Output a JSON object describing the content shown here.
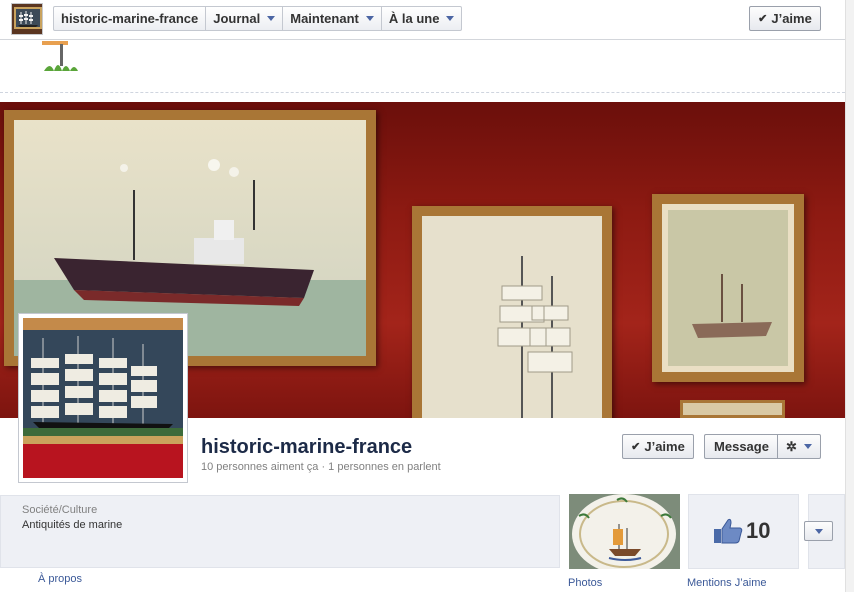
{
  "topbar": {
    "breadcrumbs": [
      "historic-marine-france",
      "Journal",
      "Maintenant",
      "À la une"
    ],
    "like_label": "J’aime"
  },
  "page": {
    "name": "historic-marine-france",
    "stats": "10 personnes aiment ça · 1 personnes en parlent",
    "like_label": "J’aime",
    "message_label": "Message"
  },
  "about": {
    "category": "Société/Culture",
    "description": "Antiquités de marine",
    "link_label": "À propos"
  },
  "tabs": {
    "photos_label": "Photos",
    "likes_label": "Mentions J’aime",
    "likes_count": "10"
  },
  "icons": {
    "check": "check-icon",
    "caret": "chevron-down-icon",
    "gear": "gear-icon",
    "thumb": "thumbs-up-icon"
  },
  "colors": {
    "link": "#3b5998",
    "title": "#1c2a47",
    "cover_wall": "#8d1a12"
  }
}
